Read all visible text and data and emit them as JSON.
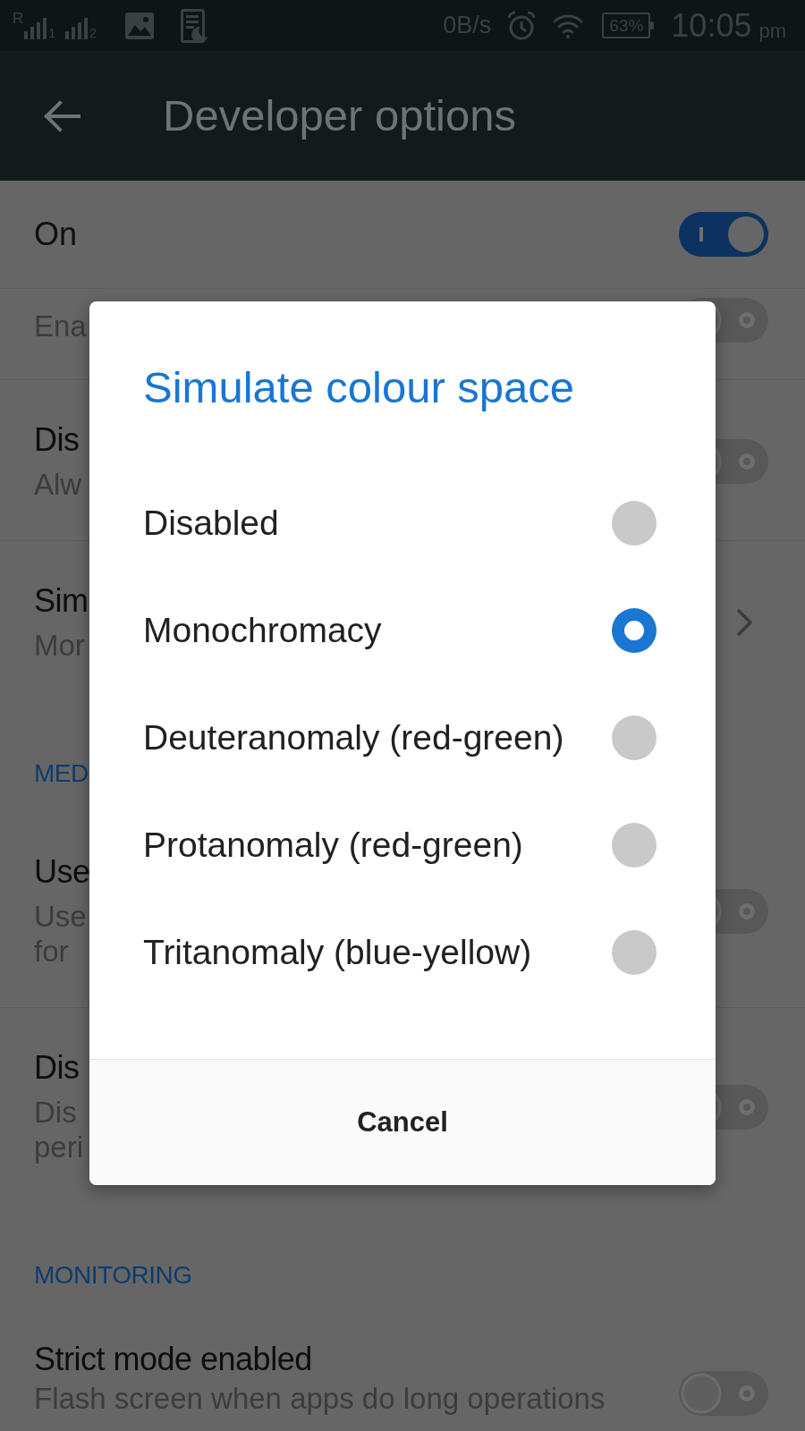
{
  "status_bar": {
    "sim_1_roaming": "R",
    "sim_1_label": "1",
    "sim_2_label": "2",
    "network_speed": "0B/s",
    "battery": "63%",
    "time": "10:05",
    "time_suffix": "pm"
  },
  "app_bar": {
    "title": "Developer options"
  },
  "master_switch": {
    "label": "On",
    "on": true
  },
  "settings": [
    {
      "kind": "toggle",
      "summary_lines": [
        "Ena"
      ],
      "on": false
    },
    {
      "kind": "toggle",
      "title": "Dis",
      "summary_lines": [
        "Alw"
      ],
      "on": false
    },
    {
      "kind": "link",
      "title": "Sim",
      "summary_lines": [
        "Mor"
      ]
    },
    {
      "kind": "section",
      "title": "MED"
    },
    {
      "kind": "toggle",
      "title": "Use",
      "summary_lines": [
        "Use",
        "for"
      ],
      "on": false
    },
    {
      "kind": "toggle",
      "title": "Dis",
      "summary_lines": [
        "Dis",
        "peri"
      ],
      "on": false
    },
    {
      "kind": "section",
      "title": "MONITORING"
    },
    {
      "kind": "toggle",
      "title": "Strict mode enabled",
      "summary_lines": [
        "Flash screen when apps do long operations"
      ],
      "on": false
    }
  ],
  "dialog": {
    "title": "Simulate colour space",
    "options": [
      {
        "label": "Disabled",
        "selected": false
      },
      {
        "label": "Monochromacy",
        "selected": true
      },
      {
        "label": "Deuteranomaly (red-green)",
        "selected": false
      },
      {
        "label": "Protanomaly (red-green)",
        "selected": false
      },
      {
        "label": "Tritanomaly (blue-yellow)",
        "selected": false
      }
    ],
    "cancel_label": "Cancel"
  }
}
